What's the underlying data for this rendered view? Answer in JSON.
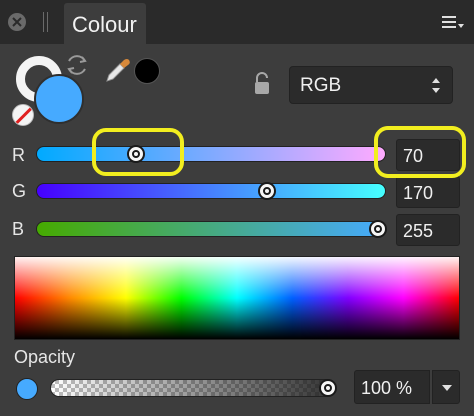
{
  "panel": {
    "title": "Colour",
    "colour_model": "RGB"
  },
  "colors": {
    "current": "#46aaff",
    "picked": "#000000",
    "highlight": "#f2ee1f"
  },
  "channels": [
    {
      "name": "R",
      "value": "70",
      "fraction": 0.2745
    },
    {
      "name": "G",
      "value": "170",
      "fraction": 0.6667
    },
    {
      "name": "B",
      "value": "255",
      "fraction": 1.0
    }
  ],
  "opacity": {
    "label": "Opacity",
    "value": "100 %",
    "fraction": 1.0
  },
  "icons": [
    "close-icon",
    "menu-icon",
    "swap-icon",
    "no-color-icon",
    "eyedropper-icon",
    "lock-icon",
    "chevron-down-icon"
  ]
}
